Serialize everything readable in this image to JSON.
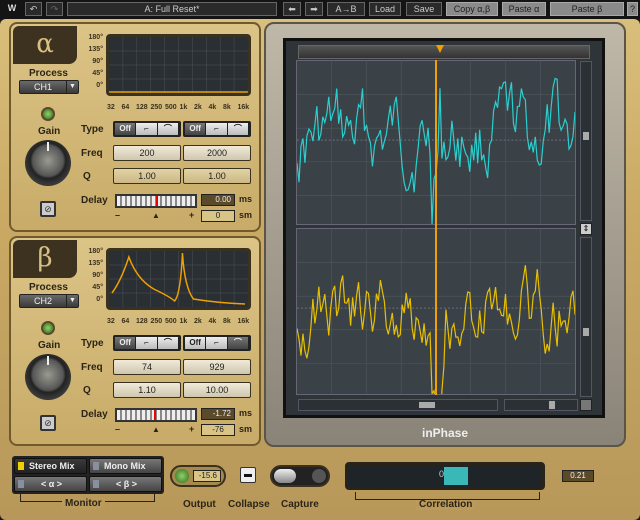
{
  "toolbar": {
    "preset": "A: Full Reset*",
    "ab": "A→B",
    "load": "Load",
    "save": "Save",
    "copy": "Copy α,β",
    "paste_a": "Paste α",
    "paste_b": "Paste β",
    "help": "?"
  },
  "graph_axis": {
    "y": [
      "180°",
      "135°",
      "90°",
      "45°",
      "0°"
    ],
    "x": [
      "32",
      "64",
      "128",
      "250",
      "500",
      "1k",
      "2k",
      "4k",
      "8k",
      "16k"
    ]
  },
  "labels": {
    "process": "Process",
    "gain": "Gain",
    "type": "Type",
    "freq": "Freq",
    "q": "Q",
    "delay": "Delay",
    "ms": "ms",
    "sm": "sm",
    "minus": "–",
    "plus": "+",
    "off": "Off"
  },
  "alpha": {
    "symbol": "α",
    "process": "CH1",
    "freq1": "200",
    "freq2": "2000",
    "q1": "1.00",
    "q2": "1.00",
    "delay_ms": "0.00",
    "delay_sm": "0",
    "delay_position": 0.5
  },
  "beta": {
    "symbol": "β",
    "process": "CH2",
    "freq1": "74",
    "freq2": "929",
    "q1": "1.10",
    "q2": "10.00",
    "delay_ms": "-1.72",
    "delay_sm": "-76",
    "delay_position": 0.48
  },
  "scope": {
    "title": "inPhase",
    "alpha_color": "#2ad0d0",
    "beta_color": "#e8c000",
    "cursor_color": "#f0a000"
  },
  "monitor": {
    "label": "Monitor",
    "stereo": "Stereo Mix",
    "mono": "Mono Mix",
    "a": "< α >",
    "b": "< β >"
  },
  "output": {
    "label": "Output",
    "value": "-15.6"
  },
  "collapse": {
    "label": "Collapse"
  },
  "capture": {
    "label": "Capture"
  },
  "correlation": {
    "label": "Correlation",
    "value": "0.21",
    "center": "0"
  }
}
